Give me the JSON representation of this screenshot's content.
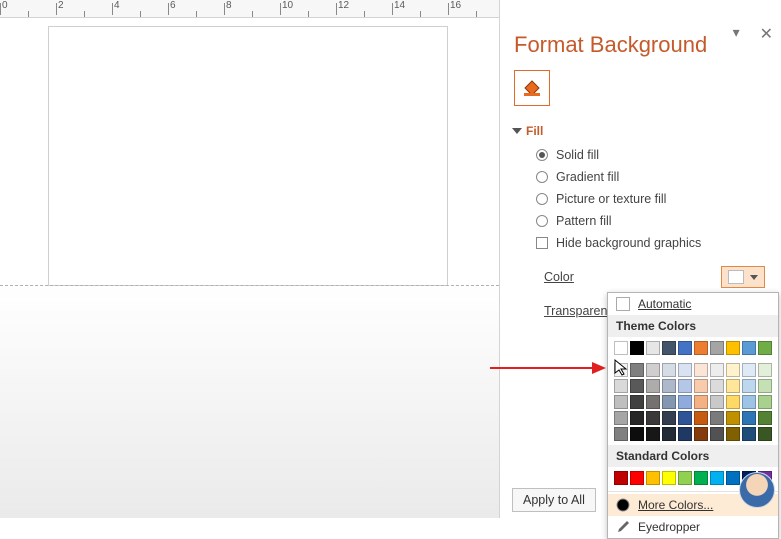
{
  "panel": {
    "title": "Format Background",
    "section_fill": "Fill",
    "options": {
      "solid": "Solid fill",
      "gradient": "Gradient fill",
      "picture": "Picture or texture fill",
      "pattern": "Pattern fill",
      "hide": "Hide background graphics"
    },
    "color_label": "Color",
    "transparency_label": "Transparenc",
    "apply_all": "Apply to All"
  },
  "picker": {
    "automatic": "Automatic",
    "theme_head": "Theme Colors",
    "standard_head": "Standard Colors",
    "more": "More Colors...",
    "eyedropper": "Eyedropper",
    "theme_row": [
      "#ffffff",
      "#000000",
      "#e7e6e6",
      "#44546a",
      "#4472c4",
      "#ed7d31",
      "#a5a5a5",
      "#ffc000",
      "#5b9bd5",
      "#70ad47"
    ],
    "theme_tints": [
      [
        "#f2f2f2",
        "#7f7f7f",
        "#d0cece",
        "#d6dce5",
        "#d9e2f3",
        "#fbe5d6",
        "#ededed",
        "#fff2cc",
        "#deebf7",
        "#e2f0d9"
      ],
      [
        "#d9d9d9",
        "#595959",
        "#aeabab",
        "#adb9ca",
        "#b4c7e7",
        "#f8cbad",
        "#dbdbdb",
        "#ffe699",
        "#bdd7ee",
        "#c5e0b4"
      ],
      [
        "#bfbfbf",
        "#404040",
        "#757171",
        "#8497b0",
        "#8faadc",
        "#f4b183",
        "#c9c9c9",
        "#ffd966",
        "#9dc3e6",
        "#a9d18e"
      ],
      [
        "#a6a6a6",
        "#262626",
        "#3a3838",
        "#333f50",
        "#2f5597",
        "#c55a11",
        "#7b7b7b",
        "#bf9000",
        "#2e75b6",
        "#548235"
      ],
      [
        "#808080",
        "#0d0d0d",
        "#171717",
        "#222a35",
        "#1f3864",
        "#843c0c",
        "#525252",
        "#806000",
        "#1f4e79",
        "#385723"
      ]
    ],
    "standard_row": [
      "#c00000",
      "#ff0000",
      "#ffc000",
      "#ffff00",
      "#92d050",
      "#00b050",
      "#00b0f0",
      "#0070c0",
      "#002060",
      "#7030a0"
    ]
  },
  "ruler": [
    "0",
    "",
    "2",
    "",
    "4",
    "",
    "6",
    "",
    "8",
    "",
    "10",
    "",
    "12",
    "",
    "14",
    "",
    "16",
    ""
  ],
  "colors": {
    "accent": "#c55a2b"
  }
}
